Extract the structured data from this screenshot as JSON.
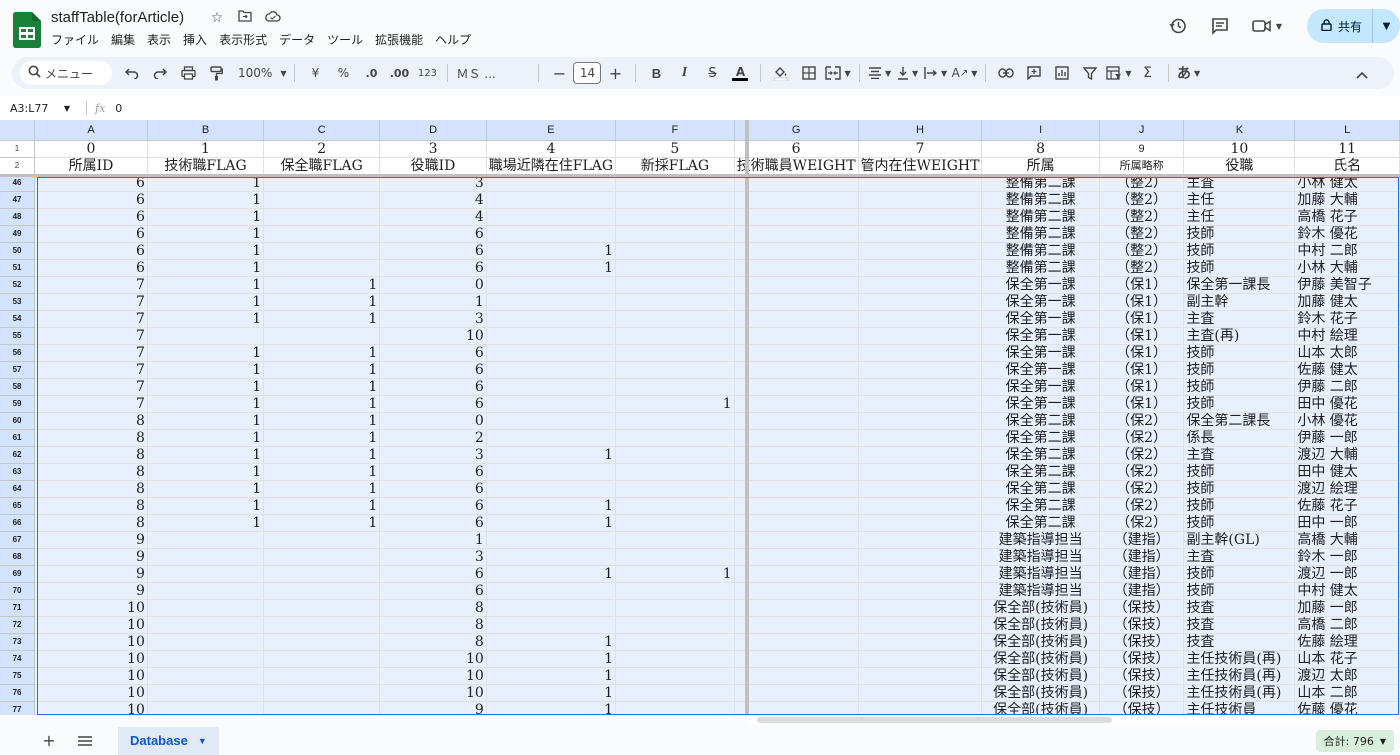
{
  "app": {
    "title": "staffTable(forArticle)",
    "menu": [
      "ファイル",
      "編集",
      "表示",
      "挿入",
      "表示形式",
      "データ",
      "ツール",
      "拡張機能",
      "ヘルプ"
    ],
    "share_label": "共有",
    "accent_color": "#0b57d0",
    "sheets_green": "#188038"
  },
  "toolbar": {
    "search_label": "メニュー",
    "zoom": "100%",
    "currency": "¥",
    "percent": "%",
    "dec_minus": ".0",
    "dec_plus": ".00",
    "format_123": "123",
    "font_name": "ＭＳ ...",
    "font_size": "14",
    "input_tool": "あ"
  },
  "formula_bar": {
    "name_box": "A3:L77",
    "fx": "fx",
    "value": "0"
  },
  "grid": {
    "columns": [
      "A",
      "B",
      "C",
      "D",
      "E",
      "F",
      "G",
      "H",
      "I",
      "J",
      "K",
      "L"
    ],
    "frozen_rows": [
      {
        "num": "1",
        "cells": [
          "0",
          "1",
          "2",
          "3",
          "4",
          "5",
          "6",
          "7",
          "8",
          "9",
          "10",
          "11"
        ]
      },
      {
        "num": "2",
        "cells": [
          "所属ID",
          "技術職FLAG",
          "保全職FLAG",
          "役職ID",
          "職場近隣在住FLAG",
          "新採FLAG",
          "技術職員WEIGHT",
          "管内在住WEIGHT",
          "所属",
          "所属略称",
          "役職",
          "氏名"
        ]
      }
    ],
    "rows": [
      {
        "num": "46",
        "cells": [
          "6",
          "1",
          "",
          "3",
          "",
          "",
          "",
          "",
          "整備第二課",
          "（整2）",
          "主査",
          "小林 健太"
        ]
      },
      {
        "num": "47",
        "cells": [
          "6",
          "1",
          "",
          "4",
          "",
          "",
          "",
          "",
          "整備第二課",
          "（整2）",
          "主任",
          "加藤 大輔"
        ]
      },
      {
        "num": "48",
        "cells": [
          "6",
          "1",
          "",
          "4",
          "",
          "",
          "",
          "",
          "整備第二課",
          "（整2）",
          "主任",
          "高橋 花子"
        ]
      },
      {
        "num": "49",
        "cells": [
          "6",
          "1",
          "",
          "6",
          "",
          "",
          "",
          "",
          "整備第二課",
          "（整2）",
          "技師",
          "鈴木 優花"
        ]
      },
      {
        "num": "50",
        "cells": [
          "6",
          "1",
          "",
          "6",
          "1",
          "",
          "",
          "",
          "整備第二課",
          "（整2）",
          "技師",
          "中村 二郎"
        ]
      },
      {
        "num": "51",
        "cells": [
          "6",
          "1",
          "",
          "6",
          "1",
          "",
          "",
          "",
          "整備第二課",
          "（整2）",
          "技師",
          "小林 大輔"
        ]
      },
      {
        "num": "52",
        "cells": [
          "7",
          "1",
          "1",
          "0",
          "",
          "",
          "",
          "",
          "保全第一課",
          "（保1）",
          "保全第一課長",
          "伊藤 美智子"
        ]
      },
      {
        "num": "53",
        "cells": [
          "7",
          "1",
          "1",
          "1",
          "",
          "",
          "",
          "",
          "保全第一課",
          "（保1）",
          "副主幹",
          "加藤 健太"
        ]
      },
      {
        "num": "54",
        "cells": [
          "7",
          "1",
          "1",
          "3",
          "",
          "",
          "",
          "",
          "保全第一課",
          "（保1）",
          "主査",
          "鈴木 花子"
        ]
      },
      {
        "num": "55",
        "cells": [
          "7",
          "",
          "",
          "10",
          "",
          "",
          "",
          "",
          "保全第一課",
          "（保1）",
          "主査(再)",
          "中村 絵理"
        ]
      },
      {
        "num": "56",
        "cells": [
          "7",
          "1",
          "1",
          "6",
          "",
          "",
          "",
          "",
          "保全第一課",
          "（保1）",
          "技師",
          "山本 太郎"
        ]
      },
      {
        "num": "57",
        "cells": [
          "7",
          "1",
          "1",
          "6",
          "",
          "",
          "",
          "",
          "保全第一課",
          "（保1）",
          "技師",
          "佐藤 健太"
        ]
      },
      {
        "num": "58",
        "cells": [
          "7",
          "1",
          "1",
          "6",
          "",
          "",
          "",
          "",
          "保全第一課",
          "（保1）",
          "技師",
          "伊藤 二郎"
        ]
      },
      {
        "num": "59",
        "cells": [
          "7",
          "1",
          "1",
          "6",
          "",
          "1",
          "",
          "",
          "保全第一課",
          "（保1）",
          "技師",
          "田中 優花"
        ]
      },
      {
        "num": "60",
        "cells": [
          "8",
          "1",
          "1",
          "0",
          "",
          "",
          "",
          "",
          "保全第二課",
          "（保2）",
          "保全第二課長",
          "小林 優花"
        ]
      },
      {
        "num": "61",
        "cells": [
          "8",
          "1",
          "1",
          "2",
          "",
          "",
          "",
          "",
          "保全第二課",
          "（保2）",
          "係長",
          "伊藤 一郎"
        ]
      },
      {
        "num": "62",
        "cells": [
          "8",
          "1",
          "1",
          "3",
          "1",
          "",
          "",
          "",
          "保全第二課",
          "（保2）",
          "主査",
          "渡辺 大輔"
        ]
      },
      {
        "num": "63",
        "cells": [
          "8",
          "1",
          "1",
          "6",
          "",
          "",
          "",
          "",
          "保全第二課",
          "（保2）",
          "技師",
          "田中 健太"
        ]
      },
      {
        "num": "64",
        "cells": [
          "8",
          "1",
          "1",
          "6",
          "",
          "",
          "",
          "",
          "保全第二課",
          "（保2）",
          "技師",
          "渡辺 絵理"
        ]
      },
      {
        "num": "65",
        "cells": [
          "8",
          "1",
          "1",
          "6",
          "1",
          "",
          "",
          "",
          "保全第二課",
          "（保2）",
          "技師",
          "佐藤 花子"
        ]
      },
      {
        "num": "66",
        "cells": [
          "8",
          "1",
          "1",
          "6",
          "1",
          "",
          "",
          "",
          "保全第二課",
          "（保2）",
          "技師",
          "田中 一郎"
        ]
      },
      {
        "num": "67",
        "cells": [
          "9",
          "",
          "",
          "1",
          "",
          "",
          "",
          "",
          "建築指導担当",
          "（建指）",
          "副主幹(GL)",
          "高橋 大輔"
        ]
      },
      {
        "num": "68",
        "cells": [
          "9",
          "",
          "",
          "3",
          "",
          "",
          "",
          "",
          "建築指導担当",
          "（建指）",
          "主査",
          "鈴木 一郎"
        ]
      },
      {
        "num": "69",
        "cells": [
          "9",
          "",
          "",
          "6",
          "1",
          "1",
          "",
          "",
          "建築指導担当",
          "（建指）",
          "技師",
          "渡辺 一郎"
        ]
      },
      {
        "num": "70",
        "cells": [
          "9",
          "",
          "",
          "6",
          "",
          "",
          "",
          "",
          "建築指導担当",
          "（建指）",
          "技師",
          "中村 健太"
        ]
      },
      {
        "num": "71",
        "cells": [
          "10",
          "",
          "",
          "8",
          "",
          "",
          "",
          "",
          "保全部(技術員)",
          "（保技）",
          "技査",
          "加藤 一郎"
        ]
      },
      {
        "num": "72",
        "cells": [
          "10",
          "",
          "",
          "8",
          "",
          "",
          "",
          "",
          "保全部(技術員)",
          "（保技）",
          "技査",
          "高橋 二郎"
        ]
      },
      {
        "num": "73",
        "cells": [
          "10",
          "",
          "",
          "8",
          "1",
          "",
          "",
          "",
          "保全部(技術員)",
          "（保技）",
          "技査",
          "佐藤 絵理"
        ]
      },
      {
        "num": "74",
        "cells": [
          "10",
          "",
          "",
          "10",
          "1",
          "",
          "",
          "",
          "保全部(技術員)",
          "（保技）",
          "主任技術員(再)",
          "山本 花子"
        ]
      },
      {
        "num": "75",
        "cells": [
          "10",
          "",
          "",
          "10",
          "1",
          "",
          "",
          "",
          "保全部(技術員)",
          "（保技）",
          "主任技術員(再)",
          "渡辺 太郎"
        ]
      },
      {
        "num": "76",
        "cells": [
          "10",
          "",
          "",
          "10",
          "1",
          "",
          "",
          "",
          "保全部(技術員)",
          "（保技）",
          "主任技術員(再)",
          "山本 二郎"
        ]
      },
      {
        "num": "77",
        "cells": [
          "10",
          "",
          "",
          "9",
          "1",
          "",
          "",
          "",
          "保全部(技術員)",
          "（保技）",
          "主任技術員",
          "佐藤 優花"
        ]
      }
    ]
  },
  "bottom": {
    "sheet_name": "Database",
    "sum_label": "合計: 796"
  }
}
